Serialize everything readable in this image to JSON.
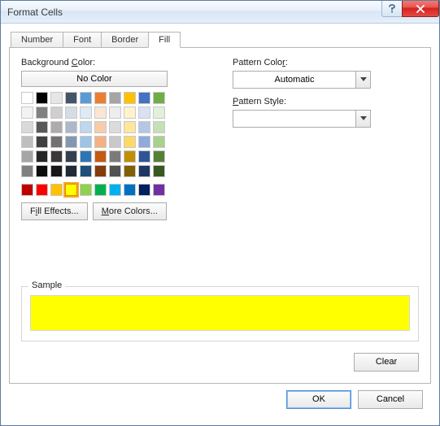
{
  "window": {
    "title": "Format Cells"
  },
  "tabs": [
    {
      "label": "Number"
    },
    {
      "label": "Font"
    },
    {
      "label": "Border"
    },
    {
      "label": "Fill"
    }
  ],
  "active_tab": "Fill",
  "fill": {
    "bg_label": "Background Color:",
    "bg_key": "C",
    "no_color_label": "No Color",
    "fill_effects_label": "Fill Effects...",
    "fill_effects_key": "I",
    "more_colors_label": "More Colors...",
    "more_colors_key": "M",
    "theme_colors": [
      "#ffffff",
      "#000000",
      "#e7e6e6",
      "#44546a",
      "#5b9bd5",
      "#ed7d31",
      "#a5a5a5",
      "#ffc000",
      "#4472c4",
      "#70ad47",
      "#f2f2f2",
      "#808080",
      "#d0cece",
      "#d6dce5",
      "#deebf7",
      "#fbe5d6",
      "#ededed",
      "#fff2cc",
      "#d9e2f3",
      "#e2efda",
      "#d9d9d9",
      "#595959",
      "#aeabab",
      "#adb9ca",
      "#bdd7ee",
      "#f8cbad",
      "#dbdbdb",
      "#ffe699",
      "#b4c7e7",
      "#c5e0b4",
      "#bfbfbf",
      "#404040",
      "#757171",
      "#8497b0",
      "#9dc3e6",
      "#f4b183",
      "#c9c9c9",
      "#ffd966",
      "#8faadc",
      "#a9d18e",
      "#a6a6a6",
      "#262626",
      "#3b3838",
      "#333f50",
      "#2e75b6",
      "#c55a11",
      "#7b7b7b",
      "#bf9000",
      "#2f5597",
      "#548235",
      "#808080",
      "#0d0d0d",
      "#171717",
      "#222a35",
      "#1f4e79",
      "#843c0c",
      "#525252",
      "#806000",
      "#203864",
      "#385723"
    ],
    "standard_colors": [
      "#c00000",
      "#ff0000",
      "#ffc000",
      "#ffff00",
      "#92d050",
      "#00b050",
      "#00b0f0",
      "#0070c0",
      "#002060",
      "#7030a0"
    ],
    "selected_color_index": 3,
    "pattern_color_label": "Pattern Color:",
    "pattern_color_key": "A",
    "pattern_color_value": "Automatic",
    "pattern_style_label": "Pattern Style:",
    "pattern_style_key": "P",
    "pattern_style_value": ""
  },
  "sample": {
    "label": "Sample",
    "color": "#ffff00"
  },
  "buttons": {
    "clear": "Clear",
    "ok": "OK",
    "cancel": "Cancel"
  }
}
